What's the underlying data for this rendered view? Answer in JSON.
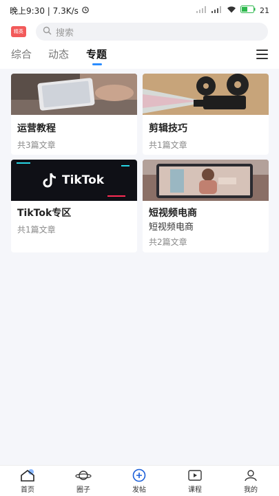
{
  "status": {
    "time_speed": "晚上9:30 | 7.3K/s",
    "battery": "21"
  },
  "header": {
    "logo_text": "精英",
    "search_placeholder": "搜索"
  },
  "tabs": [
    {
      "label": "综合"
    },
    {
      "label": "动态"
    },
    {
      "label": "专题"
    }
  ],
  "cards": [
    {
      "title": "运营教程",
      "count": "共3篇文章"
    },
    {
      "title": "剪辑技巧",
      "count": "共1篇文章"
    },
    {
      "title": "TikTok专区",
      "thumb_text": "TikTok",
      "count": "共1篇文章"
    },
    {
      "title": "短视频电商",
      "subtitle": "短视频电商",
      "count": "共2篇文章"
    }
  ],
  "bottom_nav": [
    {
      "label": "首页"
    },
    {
      "label": "圈子"
    },
    {
      "label": "发帖"
    },
    {
      "label": "课程"
    },
    {
      "label": "我的"
    }
  ],
  "colors": {
    "accent": "#2a8cff",
    "logo": "#f25a5a"
  }
}
